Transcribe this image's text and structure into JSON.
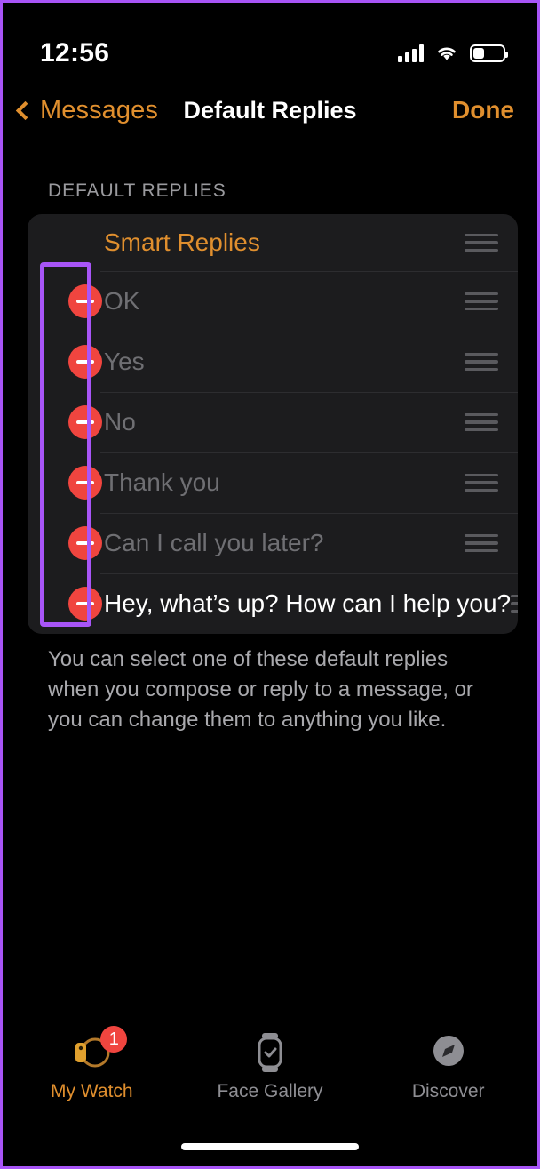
{
  "status_bar": {
    "time": "12:56",
    "cellular_icon": "cellular-signal-icon",
    "wifi_icon": "wifi-icon",
    "battery_icon": "battery-icon",
    "battery_level_percent": 38
  },
  "nav": {
    "back_label": "Messages",
    "back_icon": "chevron-left-icon",
    "title": "Default Replies",
    "done_label": "Done"
  },
  "section": {
    "header": "DEFAULT REPLIES",
    "rows": [
      {
        "label": "Smart Replies",
        "type": "header",
        "deletable": false,
        "style": "accent"
      },
      {
        "label": "OK",
        "type": "reply",
        "deletable": true,
        "style": "placeholder"
      },
      {
        "label": "Yes",
        "type": "reply",
        "deletable": true,
        "style": "placeholder"
      },
      {
        "label": "No",
        "type": "reply",
        "deletable": true,
        "style": "placeholder"
      },
      {
        "label": "Thank you",
        "type": "reply",
        "deletable": true,
        "style": "placeholder"
      },
      {
        "label": "Can I call you later?",
        "type": "reply",
        "deletable": true,
        "style": "placeholder"
      },
      {
        "label": "Hey, what’s up? How can I help you?",
        "type": "reply",
        "deletable": true,
        "style": "filled"
      }
    ],
    "delete_icon": "minus-circle-icon",
    "reorder_icon": "reorder-handle-icon",
    "footnote": "You can select one of these default replies when you compose or reply to a message, or you can change them to anything you like."
  },
  "annotation": {
    "shape": "rectangle-highlight",
    "color": "#a855f7"
  },
  "tab_bar": {
    "tabs": [
      {
        "label": "My Watch",
        "icon": "watch-icon",
        "active": true,
        "badge": "1"
      },
      {
        "label": "Face Gallery",
        "icon": "watch-face-icon",
        "active": false,
        "badge": ""
      },
      {
        "label": "Discover",
        "icon": "compass-icon",
        "active": false,
        "badge": ""
      }
    ]
  },
  "colors": {
    "accent": "#e08f2e",
    "destructive": "#f0453f",
    "card_background": "#1c1c1e",
    "screen_background": "#000000",
    "annotation": "#a855f7"
  }
}
